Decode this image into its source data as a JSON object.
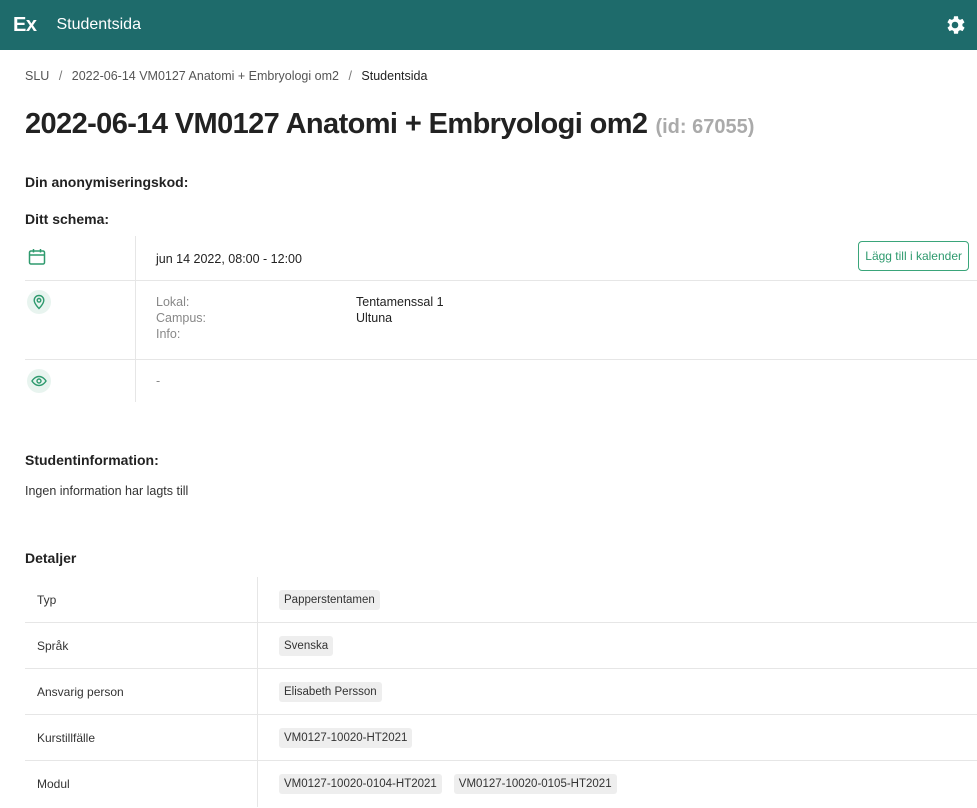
{
  "header": {
    "logo": "Ex",
    "title": "Studentsida"
  },
  "breadcrumb": {
    "root": "SLU",
    "course": "2022-06-14 VM0127 Anatomi + Embryologi om2",
    "current": "Studentsida",
    "separator": "/"
  },
  "page": {
    "title": "2022-06-14 VM0127 Anatomi + Embryologi om2",
    "id_label": "(id: 67055)"
  },
  "anonymization": {
    "heading": "Din anonymiseringskod:"
  },
  "schedule": {
    "heading": "Ditt schema:",
    "datetime": "jun 14 2022, 08:00 - 12:00",
    "calendar_button": "Lägg till i kalender",
    "location": {
      "room_label": "Lokal:",
      "room_value": "Tentamenssal 1",
      "campus_label": "Campus:",
      "campus_value": "Ultuna",
      "info_label": "Info:"
    },
    "visibility": "-"
  },
  "student_info": {
    "heading": "Studentinformation:",
    "text": "Ingen information har lagts till"
  },
  "details": {
    "heading": "Detaljer",
    "rows": [
      {
        "label": "Typ",
        "values": [
          "Papperstentamen"
        ]
      },
      {
        "label": "Språk",
        "values": [
          "Svenska"
        ]
      },
      {
        "label": "Ansvarig person",
        "values": [
          "Elisabeth Persson"
        ]
      },
      {
        "label": "Kurstillfälle",
        "values": [
          "VM0127-10020-HT2021"
        ]
      },
      {
        "label": "Modul",
        "values": [
          "VM0127-10020-0104-HT2021",
          "VM0127-10020-0105-HT2021"
        ]
      }
    ]
  },
  "colors": {
    "header_bg": "#1e6b6b",
    "accent": "#2e9a6e",
    "icon_bg": "#e8f4ef"
  },
  "icons": [
    "settings-gear-icon",
    "calendar-icon",
    "location-pin-icon",
    "eye-icon"
  ]
}
